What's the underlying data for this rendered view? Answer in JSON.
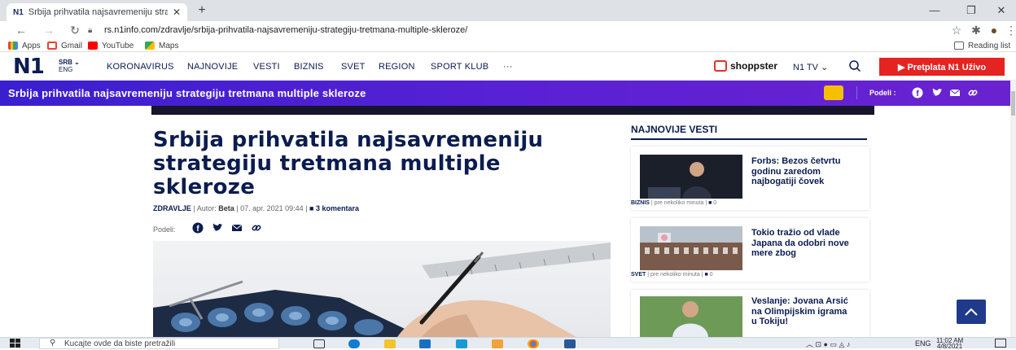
{
  "browser": {
    "tab_title": "Srbija prihvatila najsavremeniju strategiju tretmana multiple skleroze",
    "tab_favicon_text": "N1",
    "url": "rs.n1info.com/zdravlje/srbija-prihvatila-najsavremeniju-strategiju-tretmana-multiple-skleroze/",
    "bookmarks": [
      "Apps",
      "Gmail",
      "YouTube",
      "Maps"
    ],
    "reading_list": "Reading list"
  },
  "header": {
    "logo": "N1",
    "lang_primary": "SRB",
    "lang_secondary": "ENG",
    "nav": [
      "KORONAVIRUS",
      "NAJNOVIJE",
      "VESTI",
      "BIZNIS",
      "SVET",
      "REGION",
      "SPORT KLUB",
      "···"
    ],
    "shoppster": "shoppster",
    "n1tv": "N1 TV",
    "subscribe": "▶ Pretplata N1 Uživo"
  },
  "article_bar": {
    "title": "Srbija prihvatila najsavremeniju strategiju tretmana multiple skleroze",
    "share_label": "Podeli :"
  },
  "article": {
    "title": "Srbija prihvatila najsavremeniju strategiju tretmana multiple skleroze",
    "category": "ZDRAVLJE",
    "author_label": "Autor:",
    "author": "Beta",
    "date": "07. apr. 2021 09:44",
    "comments": "3 komentara",
    "share_label": "Podeli:"
  },
  "sidebar": {
    "heading": "NAJNOVIJE VESTI",
    "items": [
      {
        "title": "Forbs: Bezos četvrtu godinu zaredom najbogatiji čovek",
        "category": "BIZNIS",
        "time": "pre nekoliko minuta",
        "comments": "0"
      },
      {
        "title": "Tokio tražio od vlade Japana da odobri nove mere zbog",
        "category": "SVET",
        "time": "pre nekoliko minuta",
        "comments": "0"
      },
      {
        "title": "Veslanje: Jovana Arsić na Olimpijskim igrama u Tokiju!",
        "category": "",
        "time": "",
        "comments": ""
      }
    ]
  },
  "taskbar": {
    "search_placeholder": "Kucajte ovde da biste pretražili",
    "lang": "ENG",
    "time": "11:02 AM",
    "date": "4/8/2021"
  },
  "colors": {
    "brand_navy": "#0b1c4f",
    "bar_gradient_start": "#3a1fd0",
    "bar_gradient_end": "#6a22d0",
    "subscribe_red": "#e52320",
    "comment_yellow": "#f5c000"
  }
}
